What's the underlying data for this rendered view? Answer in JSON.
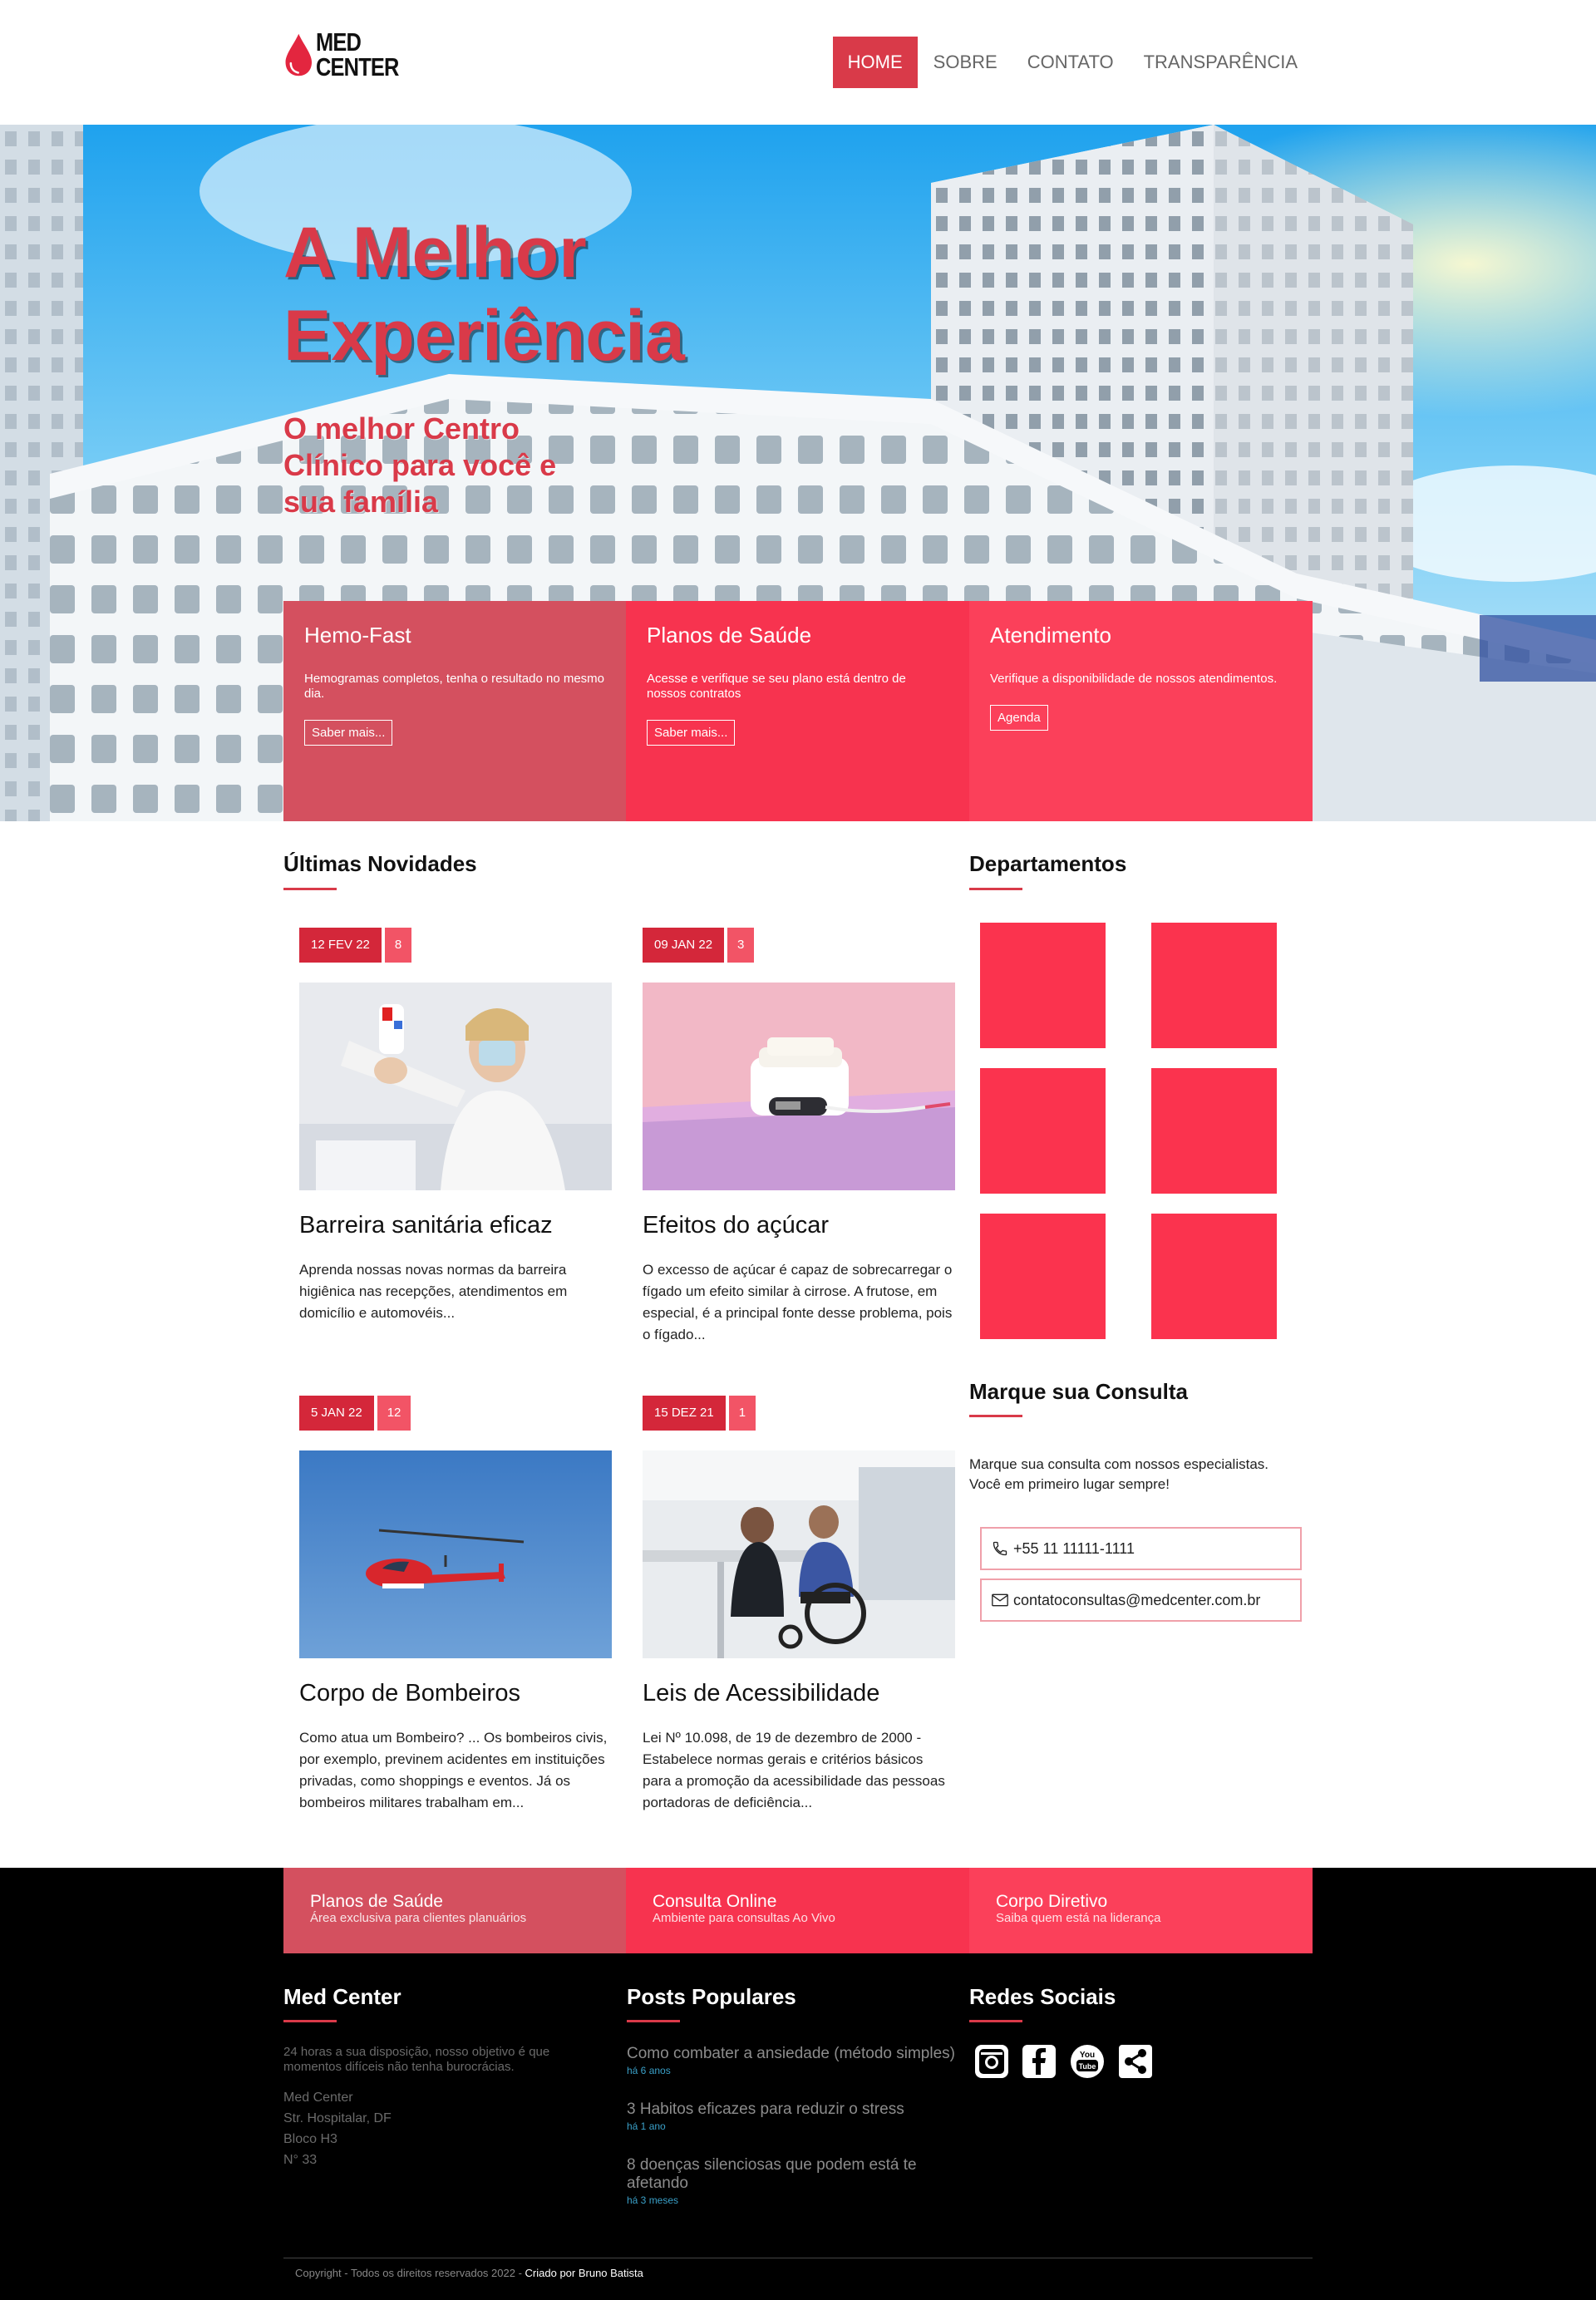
{
  "logo": {
    "line1": "MED",
    "line2": "CENTER"
  },
  "nav": {
    "home": "HOME",
    "about": "SOBRE",
    "contact": "CONTATO",
    "transparency": "TRANSPARÊNCIA"
  },
  "hero": {
    "title_line1": "A Melhor",
    "title_line2": "Experiência",
    "subtitle": "O melhor Centro Clínico para você e sua família"
  },
  "features": [
    {
      "title": "Hemo-Fast",
      "text": "Hemogramas completos, tenha o resultado no mesmo dia.",
      "button": "Saber mais..."
    },
    {
      "title": "Planos de Saúde",
      "text": "Acesse e verifique se seu plano está dentro de nossos contratos",
      "button": "Saber mais..."
    },
    {
      "title": "Atendimento",
      "text": "Verifique a disponibilidade de nossos atendimentos.",
      "button": "Agenda"
    }
  ],
  "news": {
    "title": "Últimas Novidades",
    "items": [
      {
        "date": "12 FEV 22",
        "count": "8",
        "title": "Barreira sanitária eficaz",
        "text": "Aprenda nossas novas normas da barreira higiênica nas recepções, atendimentos em domicílio e automovéis..."
      },
      {
        "date": "09 JAN 22",
        "count": "3",
        "title": "Efeitos do açúcar",
        "text": "O excesso de açúcar é capaz de sobrecarregar o fígado um efeito similar à cirrose. A frutose, em especial, é a principal fonte desse problema, pois o fígado..."
      },
      {
        "date": "5 JAN 22",
        "count": "12",
        "title": "Corpo de Bombeiros",
        "text": "Como atua um Bombeiro? ... Os bombeiros civis, por exemplo, previnem acidentes em instituições privadas, como shoppings e eventos. Já os bombeiros militares trabalham em..."
      },
      {
        "date": "15 DEZ 21",
        "count": "1",
        "title": "Leis de Acessibilidade",
        "text": "Lei Nº 10.098, de 19 de dezembro de 2000 - Estabelece normas gerais e critérios básicos para a promoção da acessibilidade das pessoas portadoras de deficiência..."
      }
    ]
  },
  "departments": {
    "title": "Departamentos"
  },
  "consult": {
    "title": "Marque sua Consulta",
    "text": "Marque sua consulta com nossos especialistas. Você em primeiro lugar sempre!",
    "phone": "+55 11 11111-1111",
    "email": "contatoconsultas@medcenter.com.br"
  },
  "footer_boxes": [
    {
      "title": "Planos de Saúde",
      "sub": "Área exclusiva para clientes planuários"
    },
    {
      "title": "Consulta Online",
      "sub": "Ambiente para consultas Ao Vivo"
    },
    {
      "title": "Corpo Diretivo",
      "sub": "Saiba quem está na liderança"
    }
  ],
  "footer": {
    "about_title": "Med Center",
    "about_text": "24 horas a sua disposição, nosso objetivo é que momentos difíceis não tenha burocrácias.",
    "address": [
      "Med Center",
      "Str. Hospitalar, DF",
      "Bloco H3",
      "N° 33"
    ],
    "posts_title": "Posts Populares",
    "posts": [
      {
        "title": "Como combater a ansiedade (método simples)",
        "date": "há 6 anos"
      },
      {
        "title": "3 Habitos eficazes para reduzir o stress",
        "date": "há 1 ano"
      },
      {
        "title": "8 doenças silenciosas que podem está te afetando",
        "date": "há 3 meses"
      }
    ],
    "social_title": "Redes Sociais",
    "social_icons": [
      "instagram-icon",
      "facebook-icon",
      "youtube-icon",
      "share-icon"
    ],
    "copyright": "Copyright - Todos os direitos reservados 2022 -",
    "credit": "Criado por Bruno Batista"
  },
  "colors": {
    "brand": "#d93a49",
    "feature1": "#d4505f",
    "feature2": "#f7334f",
    "feature3": "#fb405a"
  }
}
